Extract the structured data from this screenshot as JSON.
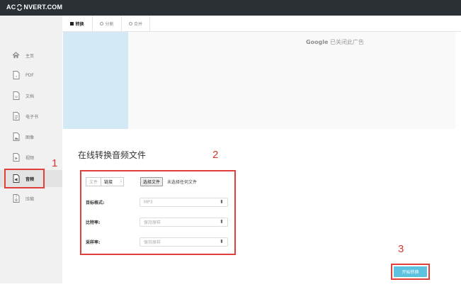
{
  "header": {
    "logo_left": "AC",
    "logo_right": "NVERT.COM"
  },
  "sidebar": {
    "items": [
      {
        "label": "主页",
        "icon": "home-icon"
      },
      {
        "label": "PDF",
        "icon": "pdf-file-icon"
      },
      {
        "label": "文档",
        "icon": "document-file-icon"
      },
      {
        "label": "电子书",
        "icon": "ebook-file-icon"
      },
      {
        "label": "图像",
        "icon": "image-file-icon"
      },
      {
        "label": "视频",
        "icon": "video-file-icon"
      },
      {
        "label": "音频",
        "icon": "audio-file-icon",
        "active": true
      },
      {
        "label": "压缩",
        "icon": "archive-file-icon"
      }
    ]
  },
  "tabs": [
    {
      "label": "转换",
      "active": true
    },
    {
      "label": "分割"
    },
    {
      "label": "合并"
    }
  ],
  "ad": {
    "brand": "Google",
    "text": "已关闭此广告"
  },
  "main": {
    "title": "在线转换音频文件",
    "source_tabs": [
      "文件",
      "链接"
    ],
    "colon": ":",
    "choose_file": "选择文件",
    "no_file": "未选择任何文件",
    "fields": [
      {
        "label": "目标格式:",
        "value": "MP3"
      },
      {
        "label": "比特率:",
        "value": "保持原样"
      },
      {
        "label": "采样率:",
        "value": "保持原样"
      }
    ],
    "start_button": "开始转换"
  },
  "annotations": {
    "n1": "1",
    "n2": "2",
    "n3": "3"
  },
  "colors": {
    "highlight": "#e0403a",
    "start_button": "#5cc2e0",
    "topbar": "#2b3035",
    "ad_block": "#d3e9f6"
  }
}
